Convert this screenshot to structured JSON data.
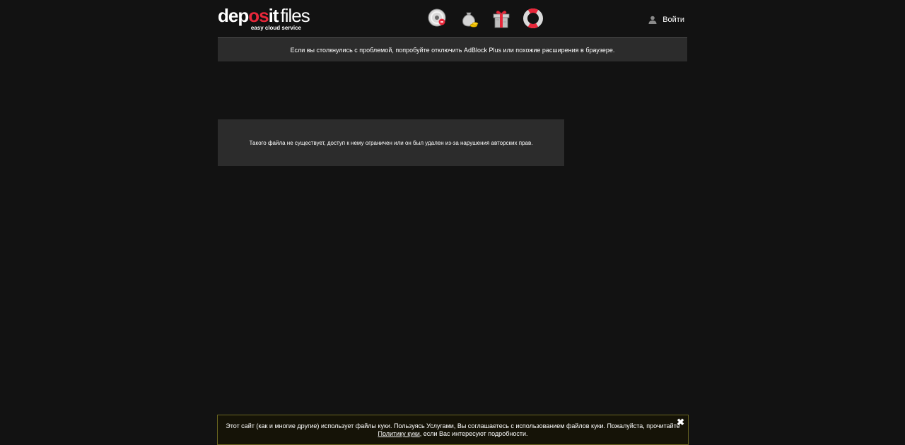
{
  "header": {
    "logo": {
      "part1": "dep",
      "part2": "os",
      "part3": "it",
      "part4": "files",
      "tagline": "easy cloud service"
    },
    "icons": [
      "disc-icon",
      "money-bag-icon",
      "gift-icon",
      "lifebuoy-icon"
    ],
    "login_label": "Войти"
  },
  "notice": {
    "text": "Если вы столкнулись с проблемой, попробуйте отключить AdBlock Plus или похожие расширения в браузере."
  },
  "error": {
    "text": "Такого файла не существует, доступ к нему ограничен или он был удален из-за нарушения авторских прав."
  },
  "cookie_banner": {
    "text_line1": "Этот сайт (как и многие другие) использует файлы куки. Пользуясь Услугами, Вы соглашаетесь с использованием файлов куки. Пожалуйста, прочитайте",
    "link_text": "Политику куки",
    "text_line2_suffix": ", если Вас интересуют подробности.",
    "close_symbol": "✖"
  },
  "colors": {
    "background": "#121212",
    "panel": "#2c2c2c",
    "brand_red": "#e8273a",
    "cookie_border": "#6b6620"
  }
}
